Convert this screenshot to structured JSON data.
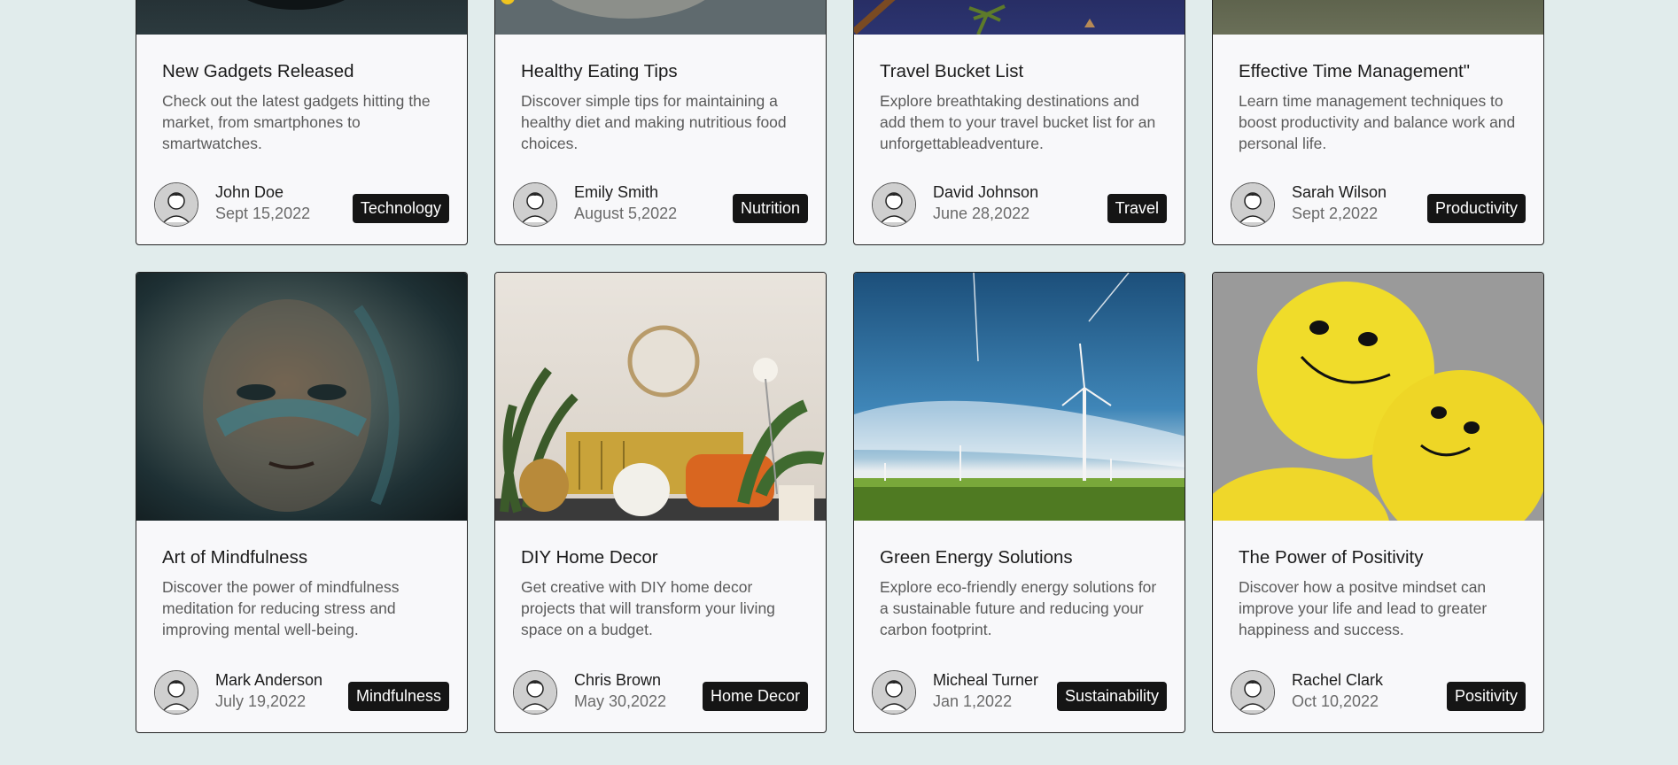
{
  "cards": [
    {
      "title": "New Gadgets Released",
      "desc": "Check out the latest gadgets hitting the market, from smartphones to smartwatches.",
      "author": "John Doe",
      "date": "Sept 15,2022",
      "tag": "Technology"
    },
    {
      "title": "Healthy Eating Tips",
      "desc": "Discover simple tips for maintaining a healthy diet and making nutritious food choices.",
      "author": "Emily Smith",
      "date": "August 5,2022",
      "tag": "Nutrition"
    },
    {
      "title": "Travel Bucket List",
      "desc": "Explore breathtaking destinations and add them to your travel bucket list for an unforgettableadventure.",
      "author": "David Johnson",
      "date": "June 28,2022",
      "tag": "Travel"
    },
    {
      "title": "Effective Time Management\"",
      "desc": "Learn time management techniques to boost productivity and balance work and personal life.",
      "author": "Sarah Wilson",
      "date": "Sept 2,2022",
      "tag": "Productivity"
    },
    {
      "title": "Art of Mindfulness",
      "desc": "Discover the power of mindfulness meditation for reducing stress and improving mental well-being.",
      "author": "Mark Anderson",
      "date": "July 19,2022",
      "tag": "Mindfulness"
    },
    {
      "title": "DIY Home Decor",
      "desc": "Get creative with DIY home decor projects that will transform your living space on a budget.",
      "author": "Chris Brown",
      "date": "May 30,2022",
      "tag": "Home Decor"
    },
    {
      "title": "Green Energy Solutions",
      "desc": "Explore eco-friendly energy solutions for a sustainable future and reducing your carbon footprint.",
      "author": "Micheal Turner",
      "date": "Jan 1,2022",
      "tag": "Sustainability"
    },
    {
      "title": "The Power of Positivity",
      "desc": "Discover how a positve mindset can improve your life and lead to greater happiness and success.",
      "author": "Rachel Clark",
      "date": "Oct 10,2022",
      "tag": "Positivity"
    }
  ]
}
